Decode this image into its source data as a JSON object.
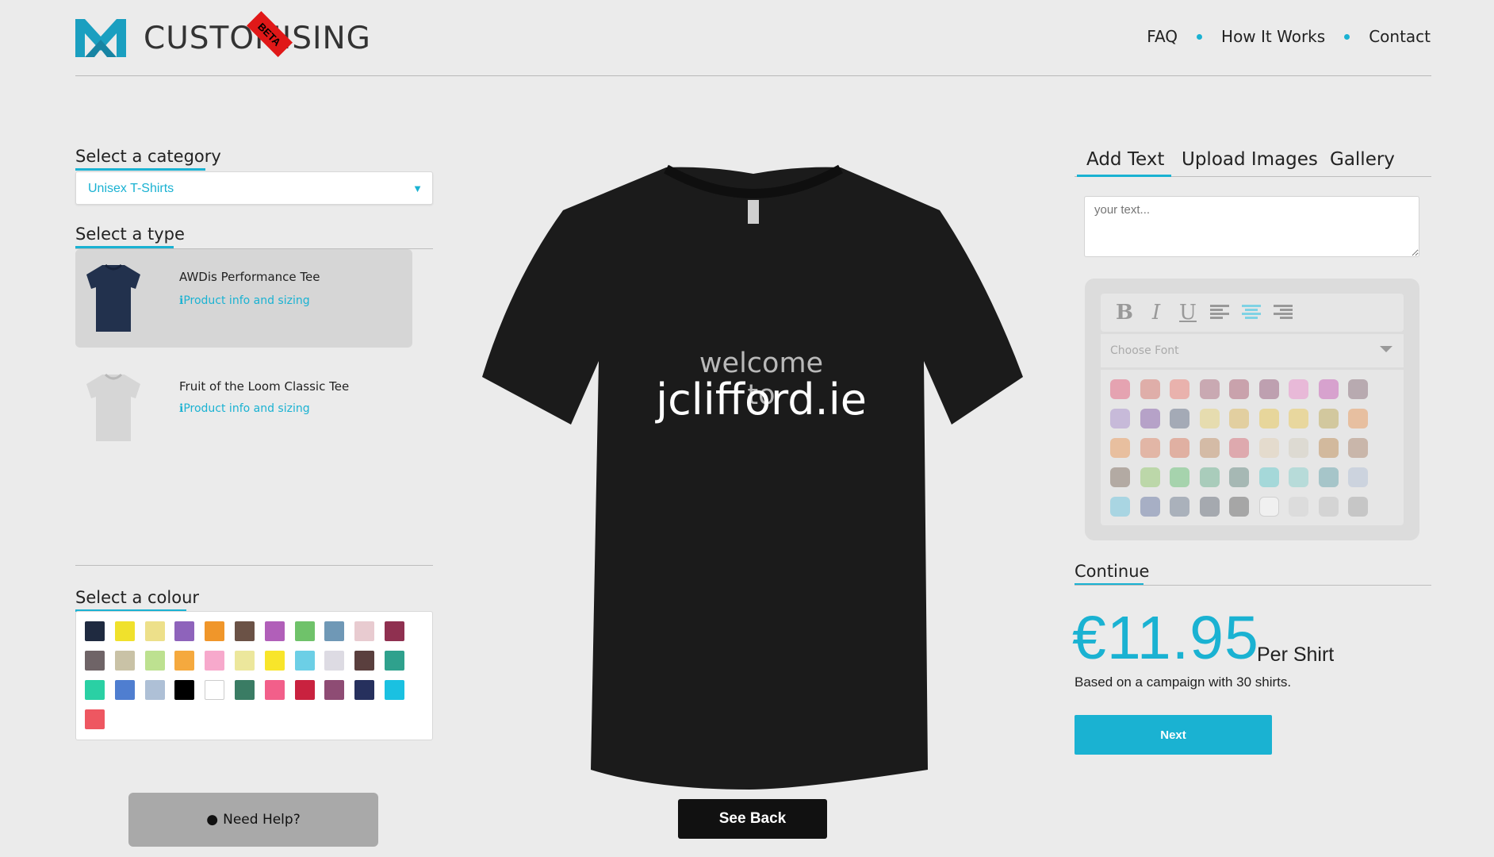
{
  "header": {
    "logo_text": "CUSTOMISING",
    "beta_label": "BETA",
    "nav": [
      "FAQ",
      "How It Works",
      "Contact"
    ]
  },
  "left": {
    "category_heading": "Select a category",
    "category_value": "Unisex T-Shirts",
    "type_heading": "Select a type",
    "products": [
      {
        "name": "AWDis Performance Tee",
        "info": "Product info and sizing",
        "shirt_color": "#22314d",
        "selected": true
      },
      {
        "name": "Fruit of the Loom Classic Tee",
        "info": "Product info and sizing",
        "shirt_color": "#cfcfcf",
        "selected": false
      }
    ],
    "colour_heading": "Select a colour",
    "colours": [
      "#1f2a40",
      "#f0e12c",
      "#ede08a",
      "#8e63bb",
      "#f0962a",
      "#6b5246",
      "#b15fb9",
      "#6fc26a",
      "#6f98b6",
      "#e8cbd0",
      "#8f3050",
      "#6f6467",
      "#c9c2a6",
      "#bde190",
      "#f5a93e",
      "#f7a9cc",
      "#ece79c",
      "#f8e52a",
      "#6ccfe6",
      "#dddbe3",
      "#5a3f3e",
      "#2fa18d",
      "#2ad0a4",
      "#4f7ed0",
      "#aec0d6",
      "#000000",
      "#ffffff",
      "#3a7c64",
      "#f25f8a",
      "#c9223f",
      "#8e4c74",
      "#26305d",
      "#1ac1e1",
      "#ee5761"
    ],
    "help_label": "Need Help?"
  },
  "shirt": {
    "color": "#1b1b1b",
    "line1": "welcome to",
    "line2": "jclifford.ie",
    "see_back": "See Back"
  },
  "right": {
    "tabs": [
      "Add Text",
      "Upload Images",
      "Gallery"
    ],
    "text_placeholder": "your text...",
    "font_placeholder": "Choose Font",
    "toolbar_icons": [
      "bold-icon",
      "italic-icon",
      "underline-icon",
      "align-left-icon",
      "align-center-icon",
      "align-right-icon"
    ],
    "text_colours": [
      "#e5a3b1",
      "#dfaea9",
      "#e9b2ad",
      "#c9a9b2",
      "#c9a2ac",
      "#bea0b0",
      "#e8b9d8",
      "#d7a2ce",
      "#b8aab0",
      "#c7bad9",
      "#b6a2c8",
      "#a4aab6",
      "#e6dcaf",
      "#e2cfa0",
      "#e7d69b",
      "#e8d79e",
      "#d2c89e",
      "#e7bfa0",
      "#e8bf9f",
      "#e2b6a6",
      "#e0b0a2",
      "#d4bba6",
      "#dea9ae",
      "#e4dbcd",
      "#dddad2",
      "#d2b99d",
      "#c9b6aa",
      "#b3aaa3",
      "#bcd7a9",
      "#a6d3ad",
      "#a9ccbb",
      "#a6b8b4",
      "#a5d8d9",
      "#b7dbd9",
      "#a6c5c9",
      "#ccd3de",
      "#a9d5e2",
      "#a7afc5",
      "#aab1bb",
      "#a5a9af",
      "#a6a6a6",
      "#f0f0f0",
      "#dcdcdc",
      "#d4d4d4",
      "#c6c6c6"
    ],
    "continue_heading": "Continue",
    "price": "€11.95",
    "per_shirt": "Per Shirt",
    "based_on": "Based on a campaign with 30 shirts.",
    "next_label": "Next"
  }
}
